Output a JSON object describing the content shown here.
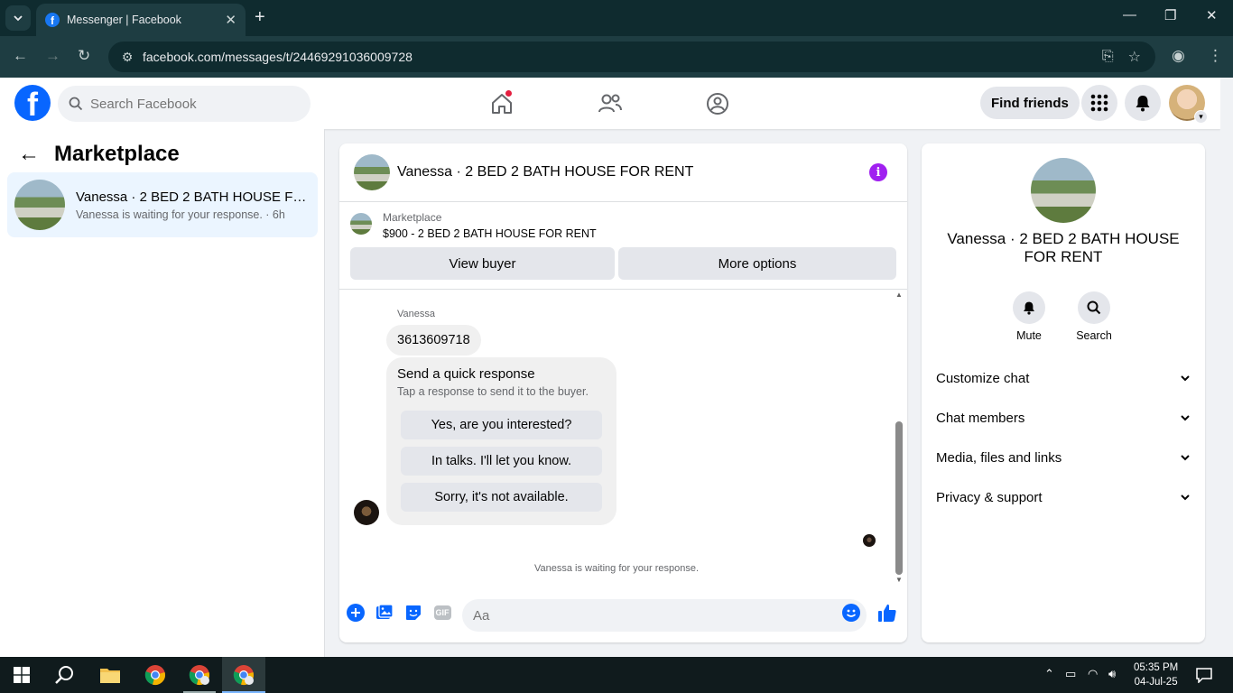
{
  "browser": {
    "tab_title": "Messenger | Facebook",
    "url": "facebook.com/messages/t/24469291036009728"
  },
  "header": {
    "search_placeholder": "Search Facebook",
    "find_friends_label": "Find friends"
  },
  "sidebar": {
    "title": "Marketplace",
    "conversations": [
      {
        "name": "Vanessa · 2 BED 2 BATH HOUSE FO...",
        "preview": "Vanessa is waiting for your response. · 6h"
      }
    ]
  },
  "chat": {
    "title": "Vanessa · 2 BED 2 BATH HOUSE FOR RENT",
    "listing": {
      "label": "Marketplace",
      "price_title": "$900 - 2 BED 2 BATH HOUSE FOR RENT",
      "view_buyer_label": "View buyer",
      "more_options_label": "More options"
    },
    "messages": {
      "sender": "Vanessa",
      "text": "3613609718"
    },
    "quick_response": {
      "title": "Send a quick response",
      "subtitle": "Tap a response to send it to the buyer.",
      "options": [
        "Yes, are you interested?",
        "In talks. I'll let you know.",
        "Sorry, it's not available."
      ]
    },
    "waiting_text": "Vanessa is waiting for your response.",
    "composer_placeholder": "Aa",
    "gif_label": "GIF"
  },
  "details": {
    "name": "Vanessa · 2 BED 2 BATH HOUSE FOR RENT",
    "actions": [
      {
        "label": "Mute",
        "icon": "bell-icon"
      },
      {
        "label": "Search",
        "icon": "search-icon"
      }
    ],
    "sections": [
      "Customize chat",
      "Chat members",
      "Media, files and links",
      "Privacy & support"
    ]
  },
  "taskbar": {
    "time": "05:35 PM",
    "date": "04-Jul-25"
  },
  "colors": {
    "fb_blue": "#0866ff",
    "info_purple": "#a020f0",
    "selected_conv": "#ebf5ff"
  }
}
